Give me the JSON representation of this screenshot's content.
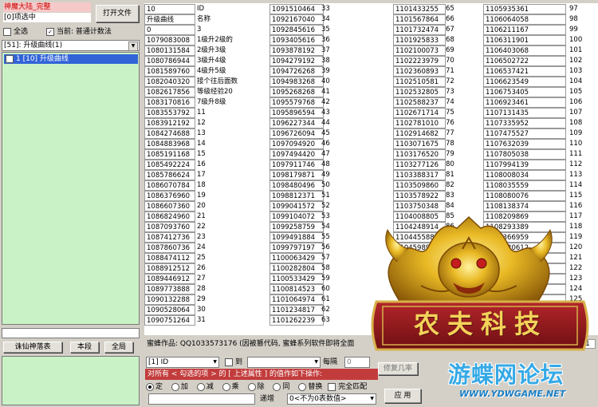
{
  "app": {
    "title": "神魔大陆_完整",
    "selected_info": "[0]项选中",
    "open_file": "打开文件",
    "select_all": "全选",
    "current_label": "当前: 普通计数法",
    "category": "[51]: 升级曲线(1)",
    "tree_item": "1      [10] 升级曲线"
  },
  "left_buttons": [
    "诛仙神落表",
    "本段",
    "全局"
  ],
  "grid": {
    "col1": [
      {
        "v": "10",
        "l": "ID"
      },
      {
        "v": "升级曲线",
        "l": "名称"
      },
      {
        "v": "0",
        "l": "3"
      },
      {
        "v": "1079083008",
        "l": "1级升2级的"
      },
      {
        "v": "1080131584",
        "l": "2级升3级"
      },
      {
        "v": "1080786944",
        "l": "3级升4级"
      },
      {
        "v": "1081589760",
        "l": "4级升5级"
      },
      {
        "v": "1082040320",
        "l": "接个往后面数"
      },
      {
        "v": "1082617856",
        "l": "等级经验20"
      },
      {
        "v": "1083170816",
        "l": "7级升8级"
      },
      {
        "v": "1083553792",
        "l": "11"
      },
      {
        "v": "1083912192",
        "l": "12"
      },
      {
        "v": "1084274688",
        "l": "13"
      },
      {
        "v": "1084883968",
        "l": "14"
      },
      {
        "v": "1085191168",
        "l": "15"
      },
      {
        "v": "1085492224",
        "l": "16"
      },
      {
        "v": "1085786624",
        "l": "17"
      },
      {
        "v": "1086070784",
        "l": "18"
      },
      {
        "v": "1086376960",
        "l": "19"
      },
      {
        "v": "1086607360",
        "l": "20"
      },
      {
        "v": "1086824960",
        "l": "21"
      },
      {
        "v": "1087093760",
        "l": "22"
      },
      {
        "v": "1087412736",
        "l": "23"
      },
      {
        "v": "1087860736",
        "l": "24"
      },
      {
        "v": "1088474112",
        "l": "25"
      },
      {
        "v": "1088912512",
        "l": "26"
      },
      {
        "v": "1089446912",
        "l": "27"
      },
      {
        "v": "1089773888",
        "l": "28"
      },
      {
        "v": "1090132288",
        "l": "29"
      },
      {
        "v": "1090528064",
        "l": "30"
      },
      {
        "v": "1090751264",
        "l": "31"
      },
      {
        "v": "1090998464",
        "l": "32"
      }
    ],
    "col2": [
      {
        "v": "1091510464",
        "l": "33"
      },
      {
        "v": "1092167040",
        "l": "34"
      },
      {
        "v": "1092845616",
        "l": "35"
      },
      {
        "v": "1093405616",
        "l": "36"
      },
      {
        "v": "1093878192",
        "l": "37"
      },
      {
        "v": "1094279192",
        "l": "38"
      },
      {
        "v": "1094726268",
        "l": "39"
      },
      {
        "v": "1094983268",
        "l": "40"
      },
      {
        "v": "1095268268",
        "l": "41"
      },
      {
        "v": "1095579768",
        "l": "42"
      },
      {
        "v": "1095896594",
        "l": "43"
      },
      {
        "v": "1096227344",
        "l": "44"
      },
      {
        "v": "1096726094",
        "l": "45"
      },
      {
        "v": "1097094920",
        "l": "46"
      },
      {
        "v": "1097494420",
        "l": "47"
      },
      {
        "v": "1097911746",
        "l": "48"
      },
      {
        "v": "1098179871",
        "l": "49"
      },
      {
        "v": "1098480496",
        "l": "50"
      },
      {
        "v": "1098812371",
        "l": "51"
      },
      {
        "v": "1099041572",
        "l": "52"
      },
      {
        "v": "1099104072",
        "l": "53"
      },
      {
        "v": "1099258759",
        "l": "54"
      },
      {
        "v": "1099491884",
        "l": "55"
      },
      {
        "v": "1099797197",
        "l": "56"
      },
      {
        "v": "1100063429",
        "l": "57"
      },
      {
        "v": "1100282804",
        "l": "58"
      },
      {
        "v": "1100533429",
        "l": "59"
      },
      {
        "v": "1100814523",
        "l": "60"
      },
      {
        "v": "1101064974",
        "l": "61"
      },
      {
        "v": "1101234817",
        "l": "62"
      },
      {
        "v": "1101262239",
        "l": "63"
      },
      {
        "v": "1101330442",
        "l": "64"
      }
    ],
    "col3": [
      {
        "v": "1101433255",
        "l": "65"
      },
      {
        "v": "1101567864",
        "l": "66"
      },
      {
        "v": "1101732474",
        "l": "67"
      },
      {
        "v": "1101925833",
        "l": "68"
      },
      {
        "v": "1102100073",
        "l": "69"
      },
      {
        "v": "1102223979",
        "l": "70"
      },
      {
        "v": "1102360893",
        "l": "71"
      },
      {
        "v": "1102510581",
        "l": "72"
      },
      {
        "v": "1102532805",
        "l": "73"
      },
      {
        "v": "1102588237",
        "l": "74"
      },
      {
        "v": "1102671714",
        "l": "75"
      },
      {
        "v": "1102781010",
        "l": "76"
      },
      {
        "v": "1102914682",
        "l": "77"
      },
      {
        "v": "1103071675",
        "l": "78"
      },
      {
        "v": "1103176520",
        "l": "79"
      },
      {
        "v": "1103277126",
        "l": "80"
      },
      {
        "v": "1103388317",
        "l": "81"
      },
      {
        "v": "1103509860",
        "l": "82"
      },
      {
        "v": "1103578922",
        "l": "83"
      },
      {
        "v": "1103750348",
        "l": "84"
      },
      {
        "v": "1104008805",
        "l": "85"
      },
      {
        "v": "1104248914",
        "l": "86"
      },
      {
        "v": "1104455887",
        "l": "87"
      },
      {
        "v": "1104598924",
        "l": "88"
      },
      {
        "v": "1104987737",
        "l": "89"
      }
    ],
    "col4": [
      {
        "v": "1105935361",
        "l": "97"
      },
      {
        "v": "1106064058",
        "l": "98"
      },
      {
        "v": "1106211167",
        "l": "99"
      },
      {
        "v": "1106311901",
        "l": "100"
      },
      {
        "v": "1106403068",
        "l": "101"
      },
      {
        "v": "1106502722",
        "l": "102"
      },
      {
        "v": "1106537421",
        "l": "103"
      },
      {
        "v": "1106623549",
        "l": "104"
      },
      {
        "v": "1106753405",
        "l": "105"
      },
      {
        "v": "1106923461",
        "l": "106"
      },
      {
        "v": "1107131435",
        "l": "107"
      },
      {
        "v": "1107335952",
        "l": "108"
      },
      {
        "v": "1107475527",
        "l": "109"
      },
      {
        "v": "1107632039",
        "l": "110"
      },
      {
        "v": "1107805038",
        "l": "111"
      },
      {
        "v": "1107994139",
        "l": "112"
      },
      {
        "v": "1108008034",
        "l": "113"
      },
      {
        "v": "1108035559",
        "l": "114"
      },
      {
        "v": "1108080076",
        "l": "115"
      },
      {
        "v": "1108138374",
        "l": "116"
      },
      {
        "v": "1108209869",
        "l": "117"
      },
      {
        "v": "1108293389",
        "l": "118"
      },
      {
        "v": "1108366959",
        "l": "119"
      },
      {
        "v": "1108420612",
        "l": "120"
      },
      {
        "v": "1108479918",
        "l": "121"
      },
      {
        "v": "",
        "l": "122"
      },
      {
        "v": "",
        "l": "123"
      },
      {
        "v": "1108528852",
        "l": "124"
      },
      {
        "v": "",
        "l": "125"
      },
      {
        "v": "",
        "l": "126"
      },
      {
        "v": "",
        "l": "127"
      },
      {
        "v": "",
        "l": "128"
      }
    ]
  },
  "status": "蜜蜂作品: QQ1033573176 (因被篡代码, 蜜蜂系列软件即将全面",
  "status_num": "1",
  "toolbar": {
    "field_select": "[1] ID",
    "to_label": "到",
    "each_label": "每隔",
    "each_value": "0",
    "batch_btn": "修复几率",
    "red_text": "对所有 < 勾选的项 > 的 [ 上述属性 ] 的值作如下操作:",
    "ops": [
      "定",
      "加",
      "减",
      "乘",
      "除",
      "同",
      "替换",
      "完全匹配"
    ],
    "increment": "递增",
    "mode": "0<不为0表数值>",
    "apply": "应 用"
  },
  "banner": {
    "title": "农夫科技"
  },
  "watermark": {
    "title": "游蝶网论坛",
    "url": "WWW.YDWGAME.NET"
  }
}
